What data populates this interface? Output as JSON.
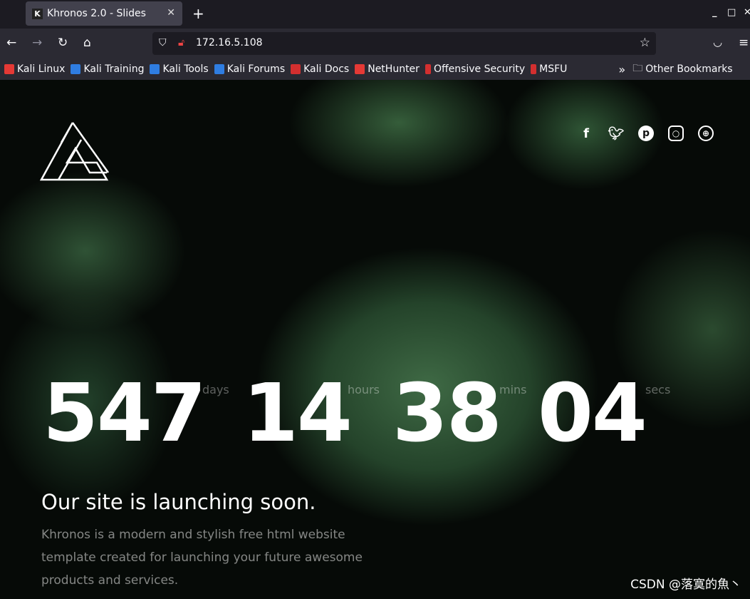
{
  "browser": {
    "tab_title": "Khronos 2.0 - Slides",
    "tab_favicon": "K",
    "url": "172.16.5.108",
    "bookmarks": [
      {
        "label": "Kali Linux",
        "color": "#e53935"
      },
      {
        "label": "Kali Training",
        "color": "#2f7de1"
      },
      {
        "label": "Kali Tools",
        "color": "#2f7de1"
      },
      {
        "label": "Kali Forums",
        "color": "#2f7de1"
      },
      {
        "label": "Kali Docs",
        "color": "#d32f2f"
      },
      {
        "label": "NetHunter",
        "color": "#e53935"
      },
      {
        "label": "Offensive Security",
        "color": "#d32f2f"
      },
      {
        "label": "MSFU",
        "color": "#d32f2f"
      }
    ],
    "other_bookmarks": "Other Bookmarks"
  },
  "page": {
    "social": [
      "facebook-icon",
      "twitter-icon",
      "pinterest-icon",
      "instagram-icon",
      "dribbble-icon"
    ],
    "countdown": {
      "days": "547",
      "days_label": "days",
      "hours": "14",
      "hours_label": "hours",
      "mins": "38",
      "mins_label": "mins",
      "secs": "04",
      "secs_label": "secs"
    },
    "title": "Our site is launching soon.",
    "description": "Khronos is a modern and stylish free html website template created for launching your future awesome products and services."
  },
  "watermark": "CSDN @落寞的魚丶"
}
